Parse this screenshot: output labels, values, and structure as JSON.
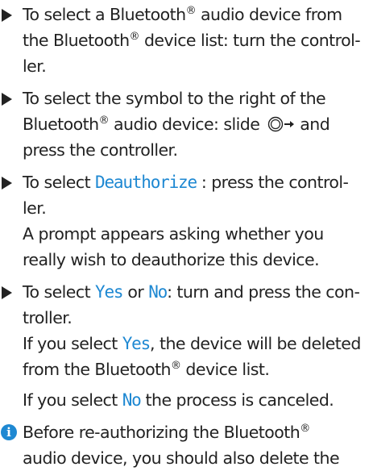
{
  "steps": [
    {
      "lines": [
        [
          "To select a Bluetooth",
          "®",
          " audio device from"
        ],
        [
          "the Bluetooth",
          "®",
          " device list: turn the control-"
        ],
        [
          "ler."
        ]
      ]
    },
    {
      "lines": [
        [
          "To select the symbol to the right of the"
        ],
        [
          "Bluetooth",
          "®",
          " audio device: slide "
        ],
        [
          "press the controller."
        ]
      ],
      "line2_suffix": " and"
    },
    {
      "line1_pre": "To select ",
      "line1_ui": "Deauthorize",
      "line1_post": " : press the control-",
      "line2": "ler."
    }
  ],
  "prompt_text": {
    "line1": "A prompt appears asking whether you",
    "line2": "really wish to deauthorize this device."
  },
  "step4": {
    "pre": "To select ",
    "yes": "Yes",
    "mid": " or ",
    "no": "No",
    "post": ": turn and press the con-",
    "line2": "troller."
  },
  "yes_result": {
    "pre": "If you select ",
    "yes": "Yes",
    "post": ", the device will be deleted",
    "line2_pre": "from the Bluetooth",
    "reg": "®",
    "line2_post": " device list."
  },
  "no_result": {
    "pre": "If you select ",
    "no": "No",
    "post": " the process is canceled."
  },
  "note": {
    "icon": "info-icon",
    "icon_glyph": "i",
    "line1_pre": "Before re-authorizing the Bluetooth",
    "reg": "®",
    "line2": "audio device, you should also delete the"
  },
  "controller_icon": "controller-slide-right-icon",
  "colors": {
    "text": "#222222",
    "ui_highlight": "#1e88d2",
    "info_icon": "#1e88d2"
  }
}
